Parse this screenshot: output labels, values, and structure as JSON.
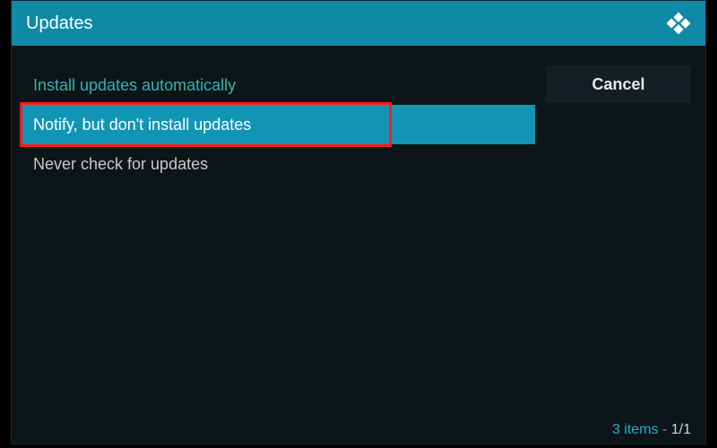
{
  "header": {
    "title": "Updates"
  },
  "options": {
    "install_auto": "Install updates automatically",
    "notify_only": "Notify, but don't install updates",
    "never_check": "Never check for updates"
  },
  "side": {
    "cancel_label": "Cancel"
  },
  "footer": {
    "count_text": "3 items",
    "sep_text": " - ",
    "page_text": "1/1"
  }
}
